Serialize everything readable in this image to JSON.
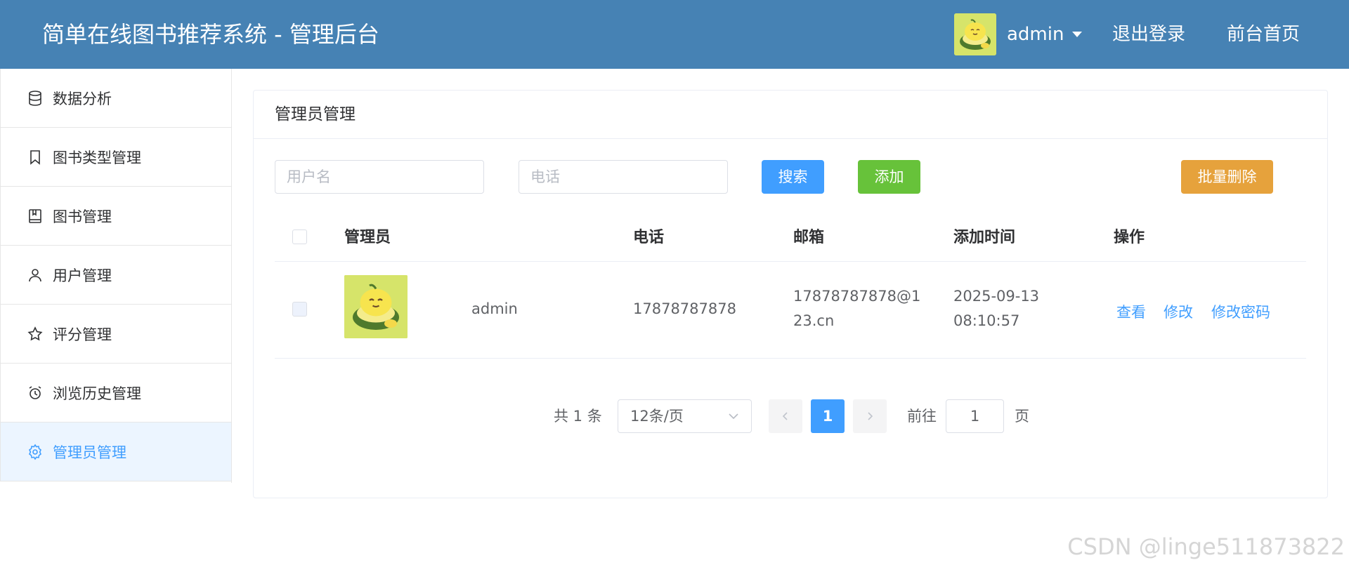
{
  "header": {
    "title": "简单在线图书推荐系统 - 管理后台",
    "user_name": "admin",
    "logout_label": "退出登录",
    "home_label": "前台首页"
  },
  "sidebar": {
    "items": [
      {
        "label": "数据分析",
        "icon": "database-icon"
      },
      {
        "label": "图书类型管理",
        "icon": "bookmark-icon"
      },
      {
        "label": "图书管理",
        "icon": "book-icon"
      },
      {
        "label": "用户管理",
        "icon": "user-icon"
      },
      {
        "label": "评分管理",
        "icon": "star-icon"
      },
      {
        "label": "浏览历史管理",
        "icon": "alarm-clock-icon"
      },
      {
        "label": "管理员管理",
        "icon": "gear-icon",
        "active": true
      }
    ]
  },
  "card": {
    "title": "管理员管理"
  },
  "toolbar": {
    "username_placeholder": "用户名",
    "phone_placeholder": "电话",
    "search_label": "搜索",
    "add_label": "添加",
    "batch_delete_label": "批量删除"
  },
  "table": {
    "headers": {
      "admin": "管理员",
      "phone": "电话",
      "email": "邮箱",
      "added_time": "添加时间",
      "actions": "操作"
    },
    "rows": [
      {
        "username": "admin",
        "phone": "17878787878",
        "email_line1": "17878787878@1",
        "email_line2": "23.cn",
        "date": "2025-09-13",
        "time": "08:10:57",
        "view_label": "查看",
        "edit_label": "修改",
        "change_pwd_label": "修改密码"
      }
    ]
  },
  "pagination": {
    "total_label": "共 1 条",
    "page_size": "12条/页",
    "current_page": "1",
    "goto_label": "前往",
    "goto_value": "1",
    "page_suffix": "页"
  },
  "watermark": "CSDN @linge511873822",
  "colors": {
    "header_bg": "#4682b4",
    "primary": "#409eff",
    "success": "#67c23a",
    "warning": "#e6a23c"
  }
}
